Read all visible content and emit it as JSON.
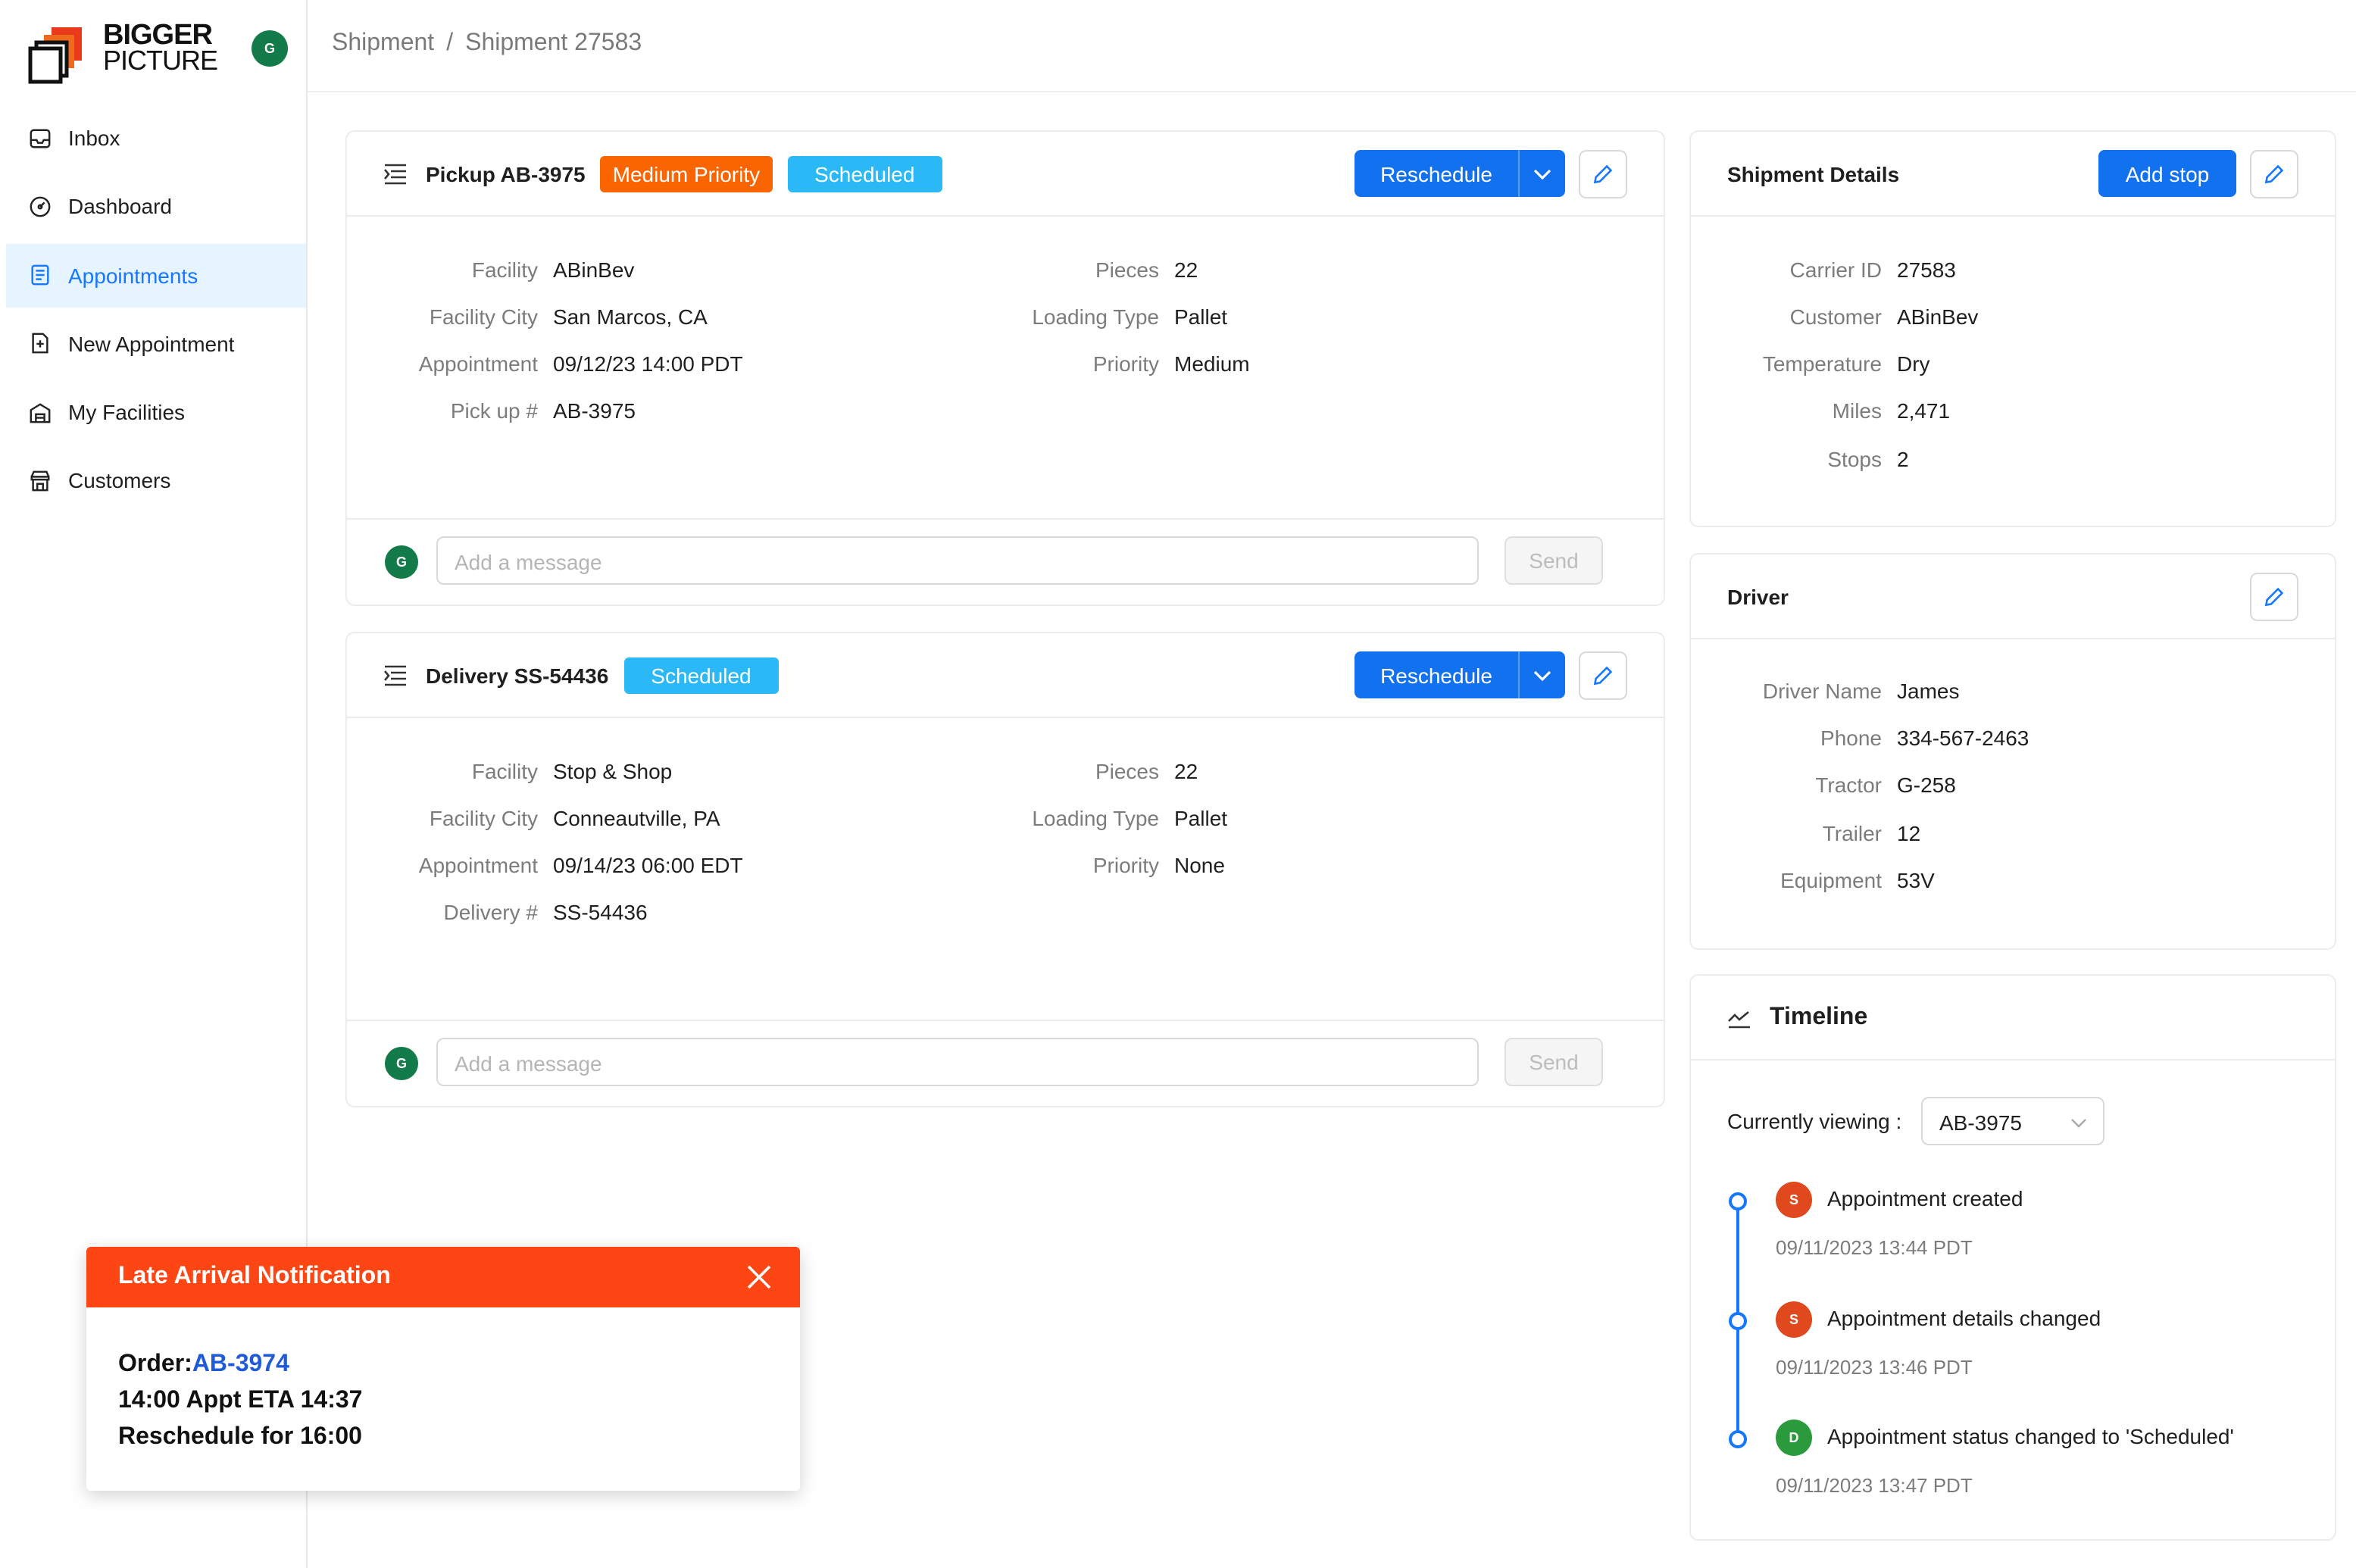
{
  "brand": {
    "line1": "BIGGER",
    "line2": "PICTURE",
    "user_initial": "G"
  },
  "sidebar": {
    "items": [
      {
        "label": "Inbox",
        "icon": "inbox-icon"
      },
      {
        "label": "Dashboard",
        "icon": "dashboard-icon"
      },
      {
        "label": "Appointments",
        "icon": "appointments-icon",
        "active": true
      },
      {
        "label": "New Appointment",
        "icon": "new-appointment-icon"
      },
      {
        "label": "My Facilities",
        "icon": "facilities-icon"
      },
      {
        "label": "Customers",
        "icon": "customers-icon"
      }
    ]
  },
  "breadcrumb": {
    "parent": "Shipment",
    "sep": "/",
    "current": "Shipment 27583"
  },
  "pickup": {
    "title": "Pickup AB-3975",
    "priority_tag": "Medium Priority",
    "status_tag": "Scheduled",
    "reschedule_label": "Reschedule",
    "left": [
      {
        "label": "Facility",
        "value": "ABinBev"
      },
      {
        "label": "Facility City",
        "value": "San Marcos, CA"
      },
      {
        "label": "Appointment",
        "value": "09/12/23 14:00 PDT"
      },
      {
        "label": "Pick up #",
        "value": "AB-3975"
      }
    ],
    "right": [
      {
        "label": "Pieces",
        "value": "22"
      },
      {
        "label": "Loading Type",
        "value": "Pallet"
      },
      {
        "label": "Priority",
        "value": "Medium"
      }
    ],
    "message_placeholder": "Add a message",
    "send_label": "Send",
    "user_initial": "G"
  },
  "delivery": {
    "title": "Delivery SS-54436",
    "status_tag": "Scheduled",
    "reschedule_label": "Reschedule",
    "left": [
      {
        "label": "Facility",
        "value": "Stop & Shop"
      },
      {
        "label": "Facility City",
        "value": "Conneautville, PA"
      },
      {
        "label": "Appointment",
        "value": "09/14/23 06:00 EDT"
      },
      {
        "label": "Delivery #",
        "value": "SS-54436"
      }
    ],
    "right": [
      {
        "label": "Pieces",
        "value": "22"
      },
      {
        "label": "Loading Type",
        "value": "Pallet"
      },
      {
        "label": "Priority",
        "value": "None"
      }
    ],
    "message_placeholder": "Add a message",
    "send_label": "Send",
    "user_initial": "G"
  },
  "shipment_details": {
    "title": "Shipment Details",
    "add_stop_label": "Add stop",
    "fields": [
      {
        "label": "Carrier ID",
        "value": "27583"
      },
      {
        "label": "Customer",
        "value": "ABinBev"
      },
      {
        "label": "Temperature",
        "value": "Dry"
      },
      {
        "label": "Miles",
        "value": "2,471"
      },
      {
        "label": "Stops",
        "value": "2"
      }
    ]
  },
  "driver": {
    "title": "Driver",
    "fields": [
      {
        "label": "Driver Name",
        "value": "James"
      },
      {
        "label": "Phone",
        "value": "334-567-2463"
      },
      {
        "label": "Tractor",
        "value": "G-258"
      },
      {
        "label": "Trailer",
        "value": "12"
      },
      {
        "label": "Equipment",
        "value": "53V"
      }
    ]
  },
  "timeline": {
    "title": "Timeline",
    "viewing_label": "Currently viewing :",
    "viewing_value": "AB-3975",
    "events": [
      {
        "initial": "S",
        "color": "#e0481d",
        "text": "Appointment created",
        "time": "09/11/2023 13:44 PDT"
      },
      {
        "initial": "S",
        "color": "#e0481d",
        "text": "Appointment details changed",
        "time": "09/11/2023 13:46 PDT"
      },
      {
        "initial": "D",
        "color": "#2a9a3c",
        "text": "Appointment status changed to 'Scheduled'",
        "time": "09/11/2023 13:47 PDT"
      }
    ]
  },
  "notification": {
    "title": "Late Arrival Notification",
    "order_label": "Order:",
    "order_value": "AB-3974",
    "line2": "14:00 Appt ETA 14:37",
    "line3": "Reschedule for 16:00"
  },
  "colors": {
    "primary": "#1271ee",
    "link": "#1677ff",
    "orange_tag": "#fa6401",
    "cyan_tag": "#2ab8f7",
    "alert": "#fe4514",
    "avatar_green": "#137b49"
  }
}
